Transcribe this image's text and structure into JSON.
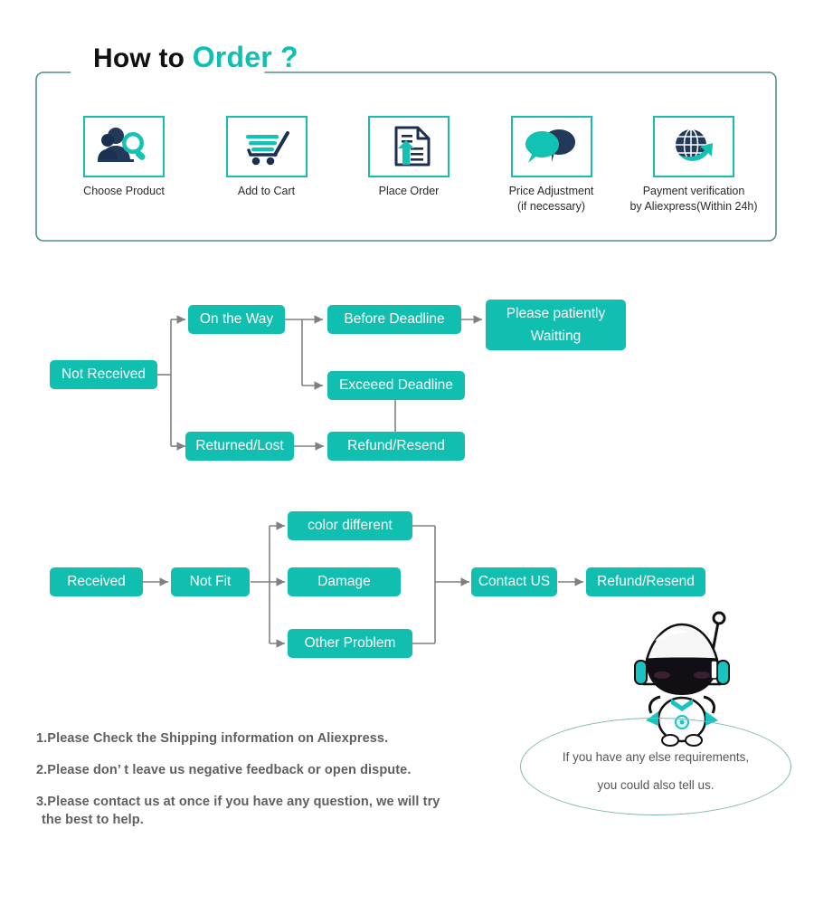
{
  "theme": {
    "teal": "#10bfb0",
    "teal_border": "#16bdb0",
    "frame_border": "#4f8f8c",
    "navy": "#22395a",
    "arrow_gray": "#808080",
    "note_gray": "#5f5f5f",
    "bubble_border": "#7fb8b3"
  },
  "header": {
    "title_part1": "How to ",
    "title_part2": "Order ?",
    "steps": [
      {
        "icon": "user-search-icon",
        "label": "Choose  Product",
        "sublabel": ""
      },
      {
        "icon": "shopping-cart-icon",
        "label": "Add to Cart",
        "sublabel": ""
      },
      {
        "icon": "upload-document-icon",
        "label": "Place  Order",
        "sublabel": ""
      },
      {
        "icon": "chat-bubbles-icon",
        "label": "Price Adjustment",
        "sublabel": "(if necessary)"
      },
      {
        "icon": "globe-arrow-icon",
        "label": "Payment verification",
        "sublabel": "by Aliexpress(Within 24h)"
      }
    ]
  },
  "flow_not_received": {
    "nodes": {
      "root": "Not Received",
      "on_the_way": "On the Way",
      "before_deadline": "Before Deadline",
      "please_wait_line1": "Please patiently",
      "please_wait_line2": "Waitting",
      "exceed_deadline": "Exceeed Deadline",
      "returned_lost": "Returned/Lost",
      "refund_resend": "Refund/Resend"
    }
  },
  "flow_received": {
    "nodes": {
      "root": "Received",
      "not_fit": "Not Fit",
      "color_different": "color different",
      "damage": "Damage",
      "other_problem": "Other Problem",
      "contact_us": "Contact US",
      "refund_resend": "Refund/Resend"
    }
  },
  "notes": {
    "line1": "1.Please Check the Shipping information on Aliexpress.",
    "line2": "2.Please don’ t leave us negative feedback or open dispute.",
    "line3": "3.Please contact us at once if you have any question, we will try",
    "line3_cont": " the best to help."
  },
  "bubble": {
    "line1": "If you have any else requirements,",
    "line2": "you could also tell us."
  }
}
